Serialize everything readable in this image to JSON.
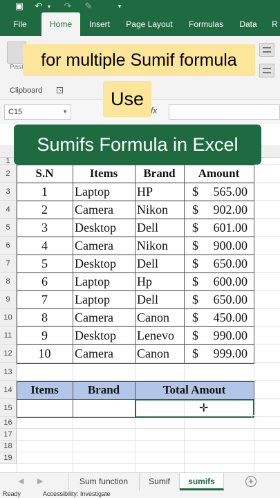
{
  "ribbon": {
    "tabs": [
      {
        "label": "File"
      },
      {
        "label": "Home"
      },
      {
        "label": "Insert"
      },
      {
        "label": "Page Layout"
      },
      {
        "label": "Formulas"
      },
      {
        "label": "Data"
      },
      {
        "label": "R"
      }
    ],
    "active_tab": "Home",
    "paste_label": "Paste",
    "clipboard_group": "Clipboard"
  },
  "formula_bar": {
    "name_box": "C15",
    "fx_label": "fx",
    "formula": ""
  },
  "captions": {
    "line1": "for multiple Sumif formula",
    "line2": "Use",
    "line3": "Sumifs Formula in Excel"
  },
  "sheet": {
    "row_numbers": [
      "1",
      "2",
      "3",
      "4",
      "5",
      "6",
      "7",
      "8",
      "9",
      "10",
      "11",
      "12",
      "13",
      "14",
      "15",
      "16",
      "17",
      "18",
      "19"
    ],
    "headers": {
      "sn": "S.N",
      "items": "Items",
      "brand": "Brand",
      "amount": "Amount"
    },
    "rows": [
      {
        "sn": "1",
        "item": "Laptop",
        "brand": "HP",
        "currency": "$",
        "amount": "565.00"
      },
      {
        "sn": "2",
        "item": "Camera",
        "brand": "Nikon",
        "currency": "$",
        "amount": "902.00"
      },
      {
        "sn": "3",
        "item": "Desktop",
        "brand": "Dell",
        "currency": "$",
        "amount": "601.00"
      },
      {
        "sn": "4",
        "item": "Camera",
        "brand": "Nikon",
        "currency": "$",
        "amount": "900.00"
      },
      {
        "sn": "5",
        "item": "Desktop",
        "brand": "Dell",
        "currency": "$",
        "amount": "650.00"
      },
      {
        "sn": "6",
        "item": "Laptop",
        "brand": "Hp",
        "currency": "$",
        "amount": "600.00"
      },
      {
        "sn": "7",
        "item": "Laptop",
        "brand": "Dell",
        "currency": "$",
        "amount": "650.00"
      },
      {
        "sn": "8",
        "item": "Camera",
        "brand": "Canon",
        "currency": "$",
        "amount": "450.00"
      },
      {
        "sn": "9",
        "item": "Desktop",
        "brand": "Lenevo",
        "currency": "$",
        "amount": "990.00"
      },
      {
        "sn": "10",
        "item": "Camera",
        "brand": "Canon",
        "currency": "$",
        "amount": "999.00"
      }
    ],
    "summary_headers": {
      "items": "Items",
      "brand": "Brand",
      "total": "Total Amout"
    },
    "colors": {
      "excel_green": "#1e6b41",
      "summary_header": "#b4c6e7",
      "caption_yellow": "#fde59a"
    }
  },
  "sheet_tabs": [
    {
      "label": "Sum function"
    },
    {
      "label": "Sumif"
    },
    {
      "label": "sumifs"
    }
  ],
  "active_sheet": "sumifs",
  "status": {
    "ready": "Ready",
    "accessibility": "Accessibility: Investigate"
  }
}
